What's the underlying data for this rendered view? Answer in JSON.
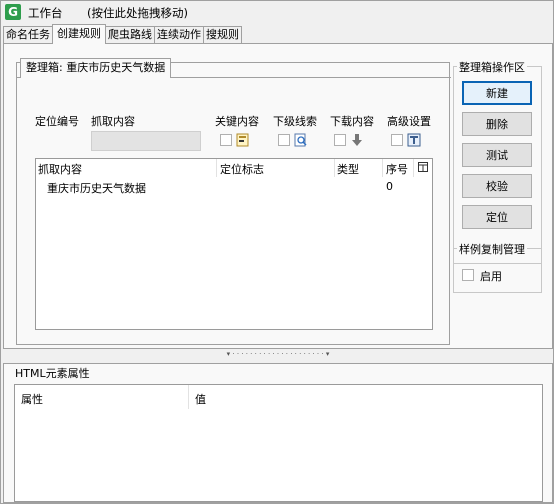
{
  "window": {
    "app_icon_letter": "G",
    "title": "工作台",
    "drag_hint": "(按住此处拖拽移动)"
  },
  "tabs": [
    {
      "label": "命名任务",
      "active": false
    },
    {
      "label": "创建规则",
      "active": true
    },
    {
      "label": "爬虫路线",
      "active": false
    },
    {
      "label": "连续动作",
      "active": false
    },
    {
      "label": "搜规则",
      "active": false
    }
  ],
  "box": {
    "label_prefix": "整理箱:",
    "name": "重庆市历史天气数据"
  },
  "fields": {
    "locate_number_label": "定位编号",
    "capture_content_label": "抓取内容",
    "capture_content_value": "",
    "keyword_label": "关键内容",
    "sub_clue_label": "下级线索",
    "download_label": "下载内容",
    "advanced_label": "高级设置"
  },
  "table": {
    "columns": [
      "抓取内容",
      "定位标志",
      "类型",
      "序号"
    ],
    "rows": [
      {
        "content": "重庆市历史天气数据",
        "locator": "",
        "type": "",
        "index": "0"
      }
    ]
  },
  "box_ops": {
    "title": "整理箱操作区",
    "buttons": [
      "新建",
      "删除",
      "测试",
      "校验",
      "定位"
    ]
  },
  "sample_copy": {
    "title": "样例复制管理",
    "enable_label": "启用",
    "enabled": false
  },
  "html_attrs": {
    "title": "HTML元素属性",
    "columns": [
      "属性",
      "值"
    ]
  },
  "colors": {
    "accent_border": "#0a64b4",
    "app_icon_bg": "#2e9d4c"
  }
}
